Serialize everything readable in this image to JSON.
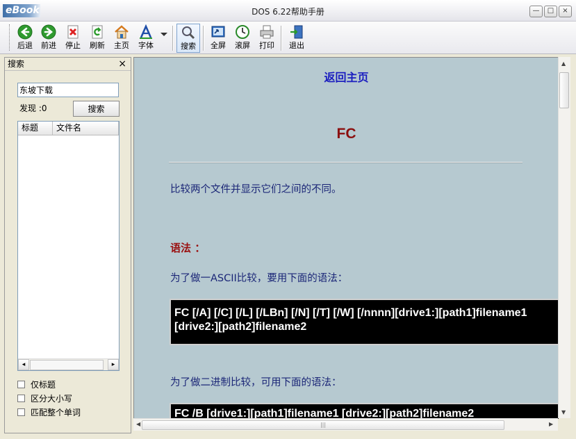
{
  "app": {
    "logo": "eBook",
    "title": "DOS  6.22帮助手册"
  },
  "window_controls": {
    "minimize": "—",
    "maximize": "□",
    "close": "×"
  },
  "toolbar": {
    "back": "后退",
    "forward": "前进",
    "stop": "停止",
    "refresh": "刷新",
    "home": "主页",
    "font": "字体",
    "search": "搜索",
    "fullscreen": "全屏",
    "scroll": "滚屏",
    "print": "打印",
    "exit": "退出"
  },
  "search_panel": {
    "title": "搜索",
    "close": "×",
    "query": "东坡下载",
    "found": "发现 :0",
    "search_button": "搜索",
    "columns": [
      "标题",
      "文件名"
    ],
    "options": [
      "仅标题",
      "区分大小写",
      "匹配整个单词"
    ]
  },
  "content": {
    "back_link": "返回主页",
    "heading": "FC",
    "description": "比较两个文件并显示它们之间的不同。",
    "syntax_label": "语法 ：",
    "ascii_intro": "为了做一ASCII比较，要用下面的语法：",
    "ascii_syntax_line1": "FC [/A] [/C] [/L] [/LBn] [/N] [/T] [/W] [/nnnn][drive1:][path1]filename1",
    "ascii_syntax_line2": "[drive2:][path2]filename2",
    "binary_intro": "为了做二进制比较，可用下面的语法：",
    "binary_syntax": "FC /B [drive1:][path1]filename1 [drive2:][path2]filename2"
  },
  "colors": {
    "content_bg": "#b6c9d0",
    "link": "#1b1ebf",
    "heading": "#8b0f0f",
    "body_text": "#1b2677",
    "code_bg": "#000000"
  }
}
